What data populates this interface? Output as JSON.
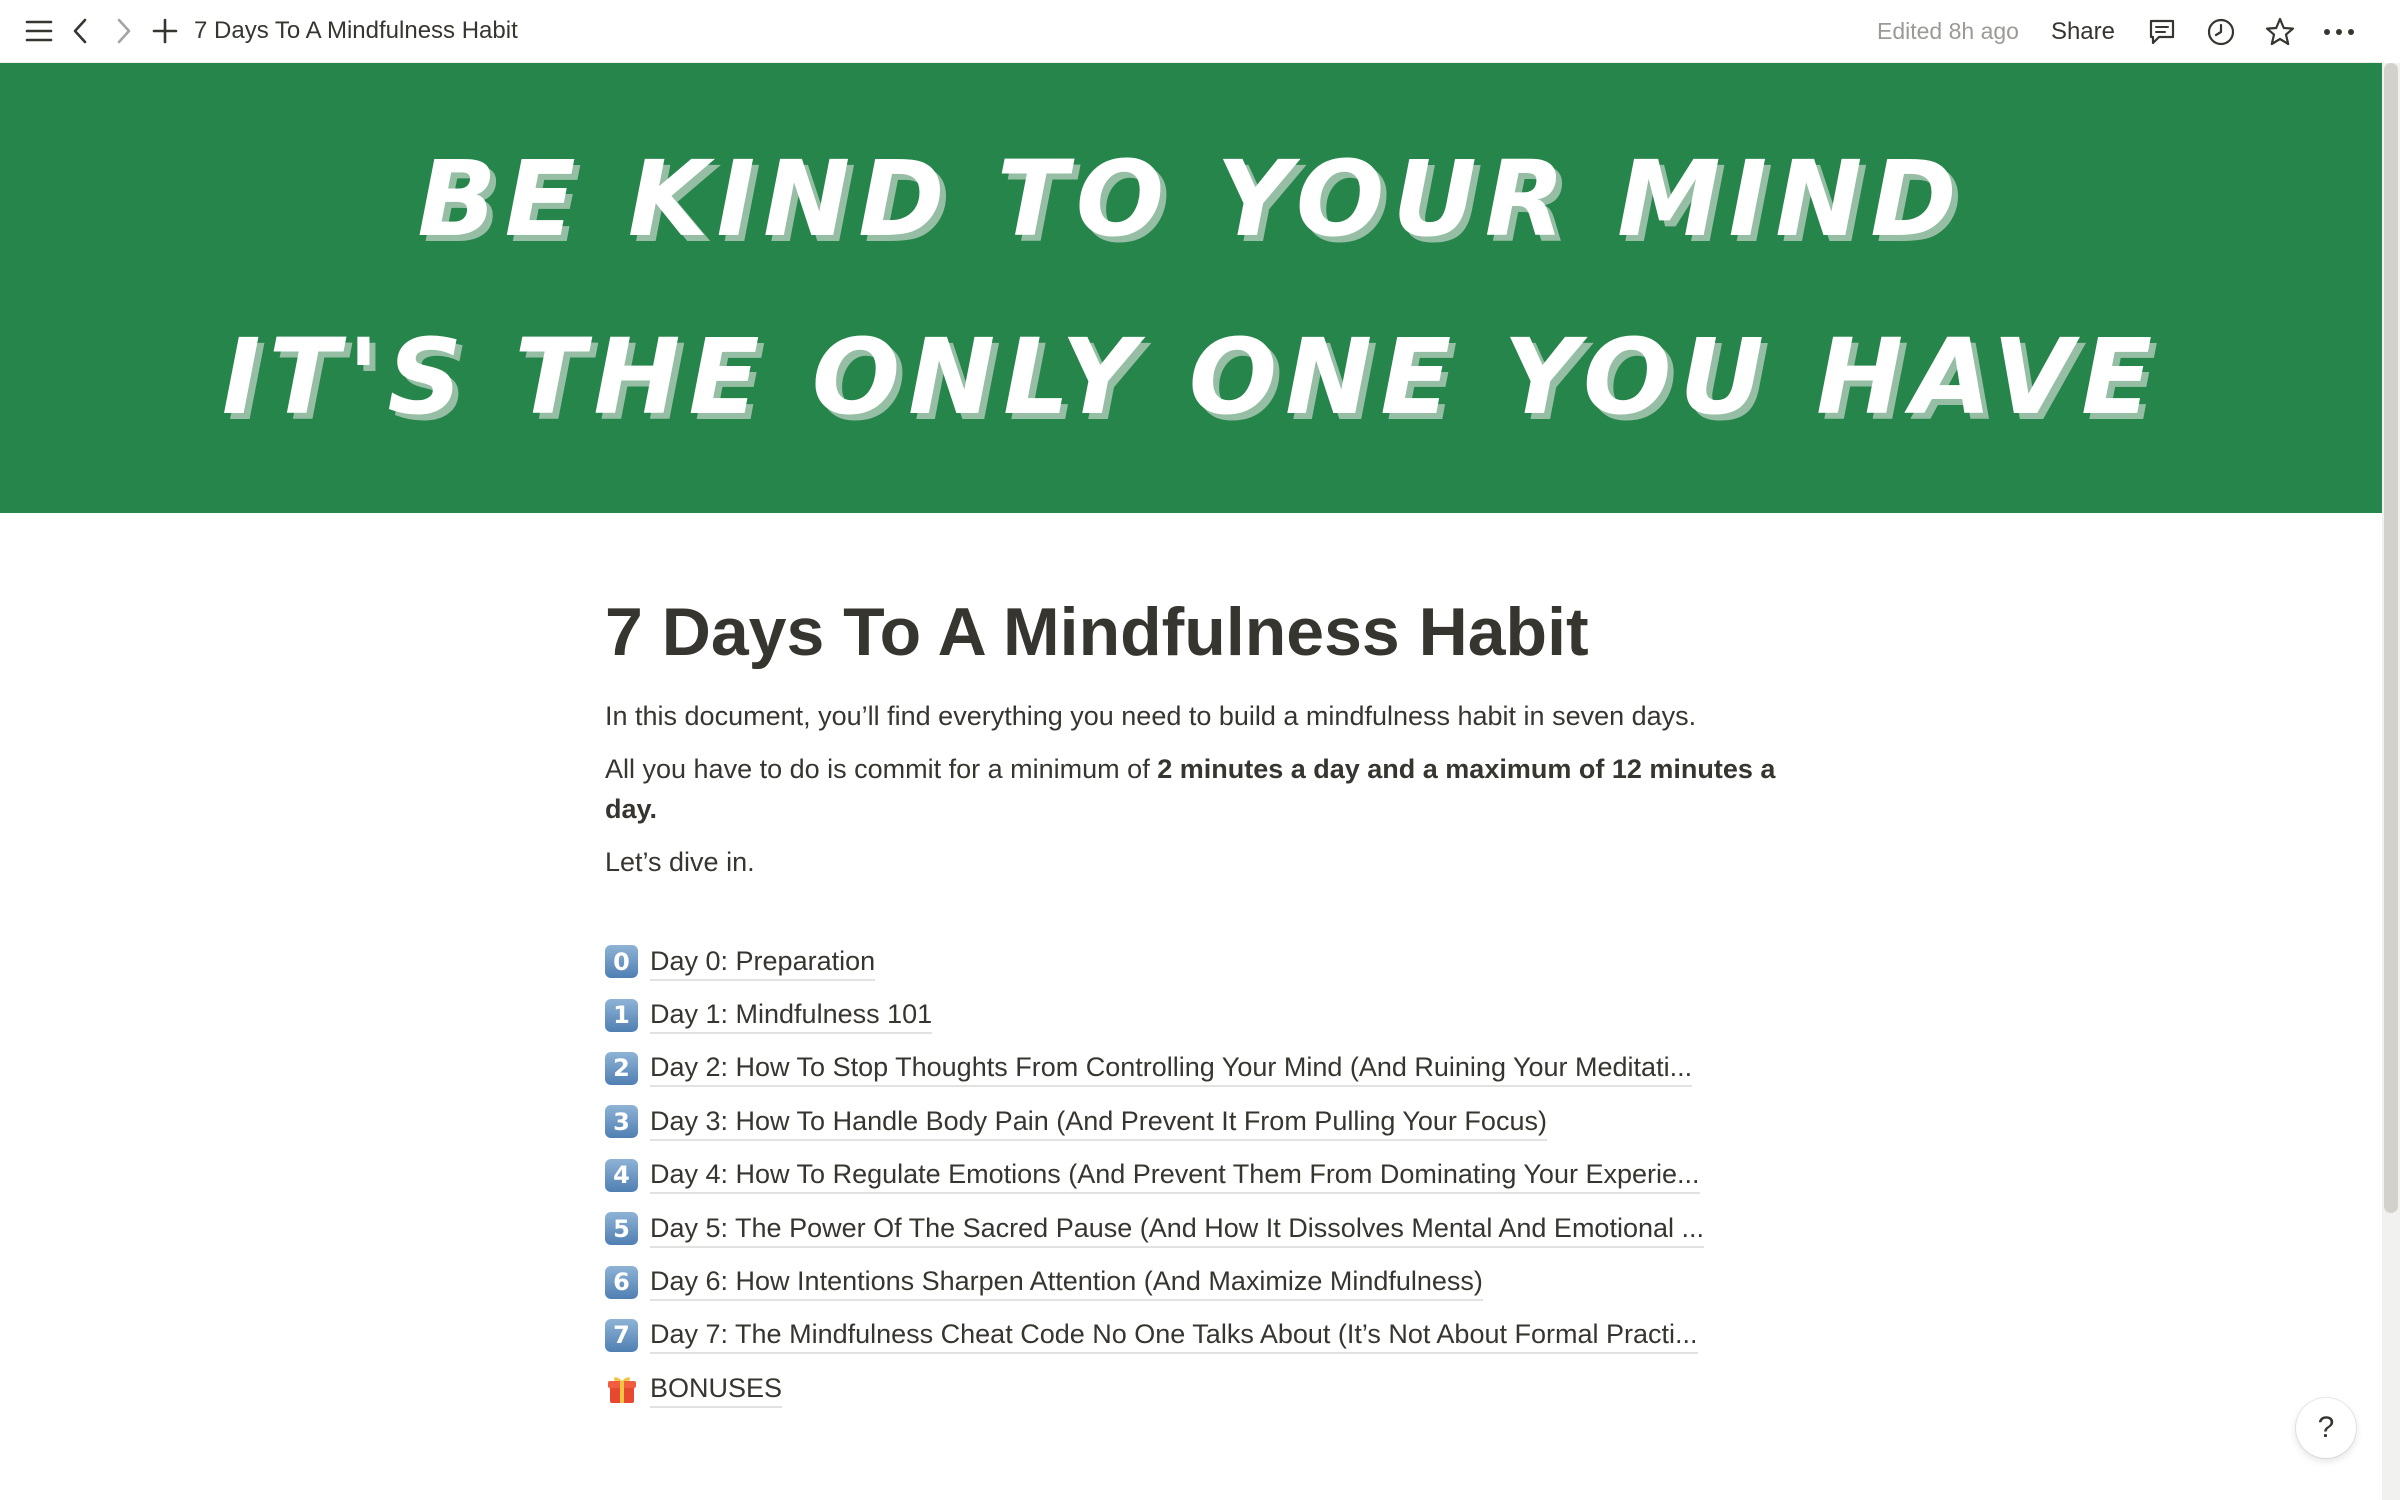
{
  "topbar": {
    "breadcrumb_title": "7 Days To A Mindfulness Habit",
    "edited_label": "Edited 8h ago",
    "share_label": "Share",
    "icons": [
      "menu-icon",
      "back-arrow-icon",
      "forward-arrow-icon",
      "plus-icon",
      "comment-icon",
      "clock-icon",
      "star-icon",
      "more-icon"
    ]
  },
  "cover": {
    "line1": "BE KIND TO YOUR MIND",
    "line2": "IT'S THE ONLY ONE YOU HAVE",
    "background_color": "#26854a"
  },
  "page": {
    "title": "7 Days To A Mindfulness Habit",
    "intro": "In this document, you’ll find everything you need to build a mindfulness habit in seven days.",
    "commit_prefix": "All you have to do is commit for a minimum of ",
    "commit_bold": "2 minutes a day and a maximum of 12 minutes a day.",
    "dive_in": "Let’s dive in."
  },
  "links": [
    {
      "number": "0",
      "label": "Day 0: Preparation"
    },
    {
      "number": "1",
      "label": "Day 1: Mindfulness 101"
    },
    {
      "number": "2",
      "label": "Day 2: How To Stop Thoughts From Controlling Your Mind (And Ruining Your Meditati..."
    },
    {
      "number": "3",
      "label": "Day 3: How To Handle Body Pain (And Prevent It From Pulling Your Focus)"
    },
    {
      "number": "4",
      "label": "Day 4: How To Regulate Emotions (And Prevent Them From Dominating Your Experie..."
    },
    {
      "number": "5",
      "label": "Day 5: The Power Of The Sacred Pause (And How It Dissolves Mental And Emotional ..."
    },
    {
      "number": "6",
      "label": "Day 6: How Intentions Sharpen Attention (And Maximize Mindfulness)"
    },
    {
      "number": "7",
      "label": "Day 7: The Mindfulness Cheat Code No One Talks About (It’s Not About Formal Practi..."
    }
  ],
  "bonuses": {
    "label": "BONUSES",
    "icon": "gift-icon"
  },
  "help": {
    "label": "?"
  }
}
